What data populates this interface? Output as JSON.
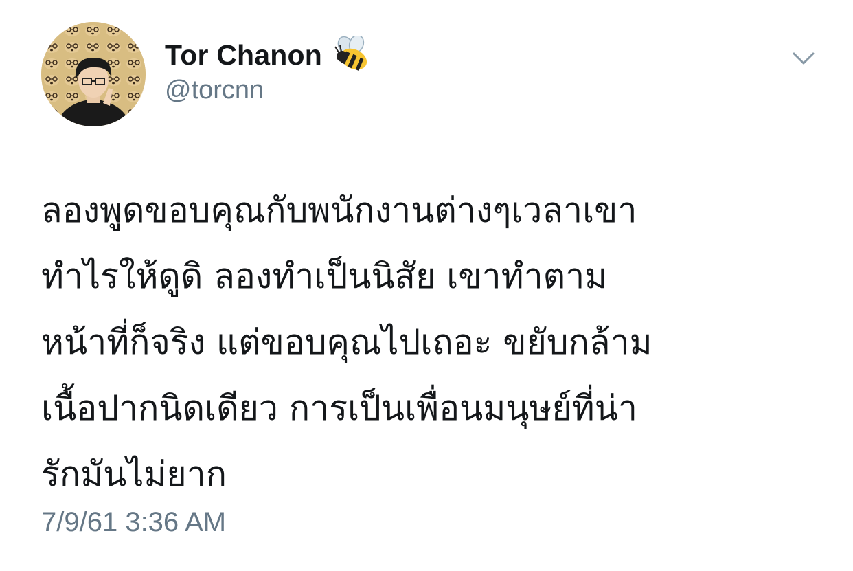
{
  "user": {
    "display_name": "Tor Chanon",
    "handle": "@torcnn",
    "name_emoji": "bee-icon"
  },
  "tweet": {
    "lines": [
      "ลองพูดขอบคุณกับพนักงานต่างๆเวลาเขา",
      "ทำไรให้ดูดิ ลองทำเป็นนิสัย เขาทำตาม",
      "หน้าที่ก็จริง แต่ขอบคุณไปเถอะ ขยับกล้าม",
      "เนื้อปากนิดเดียว การเป็นเพื่อนมนุษย์ที่น่า",
      "รักมันไม่ยาก"
    ],
    "timestamp": "7/9/61 3:36 AM"
  },
  "colors": {
    "text": "#14171a",
    "secondary": "#657786",
    "divider": "#e1e8ed"
  }
}
